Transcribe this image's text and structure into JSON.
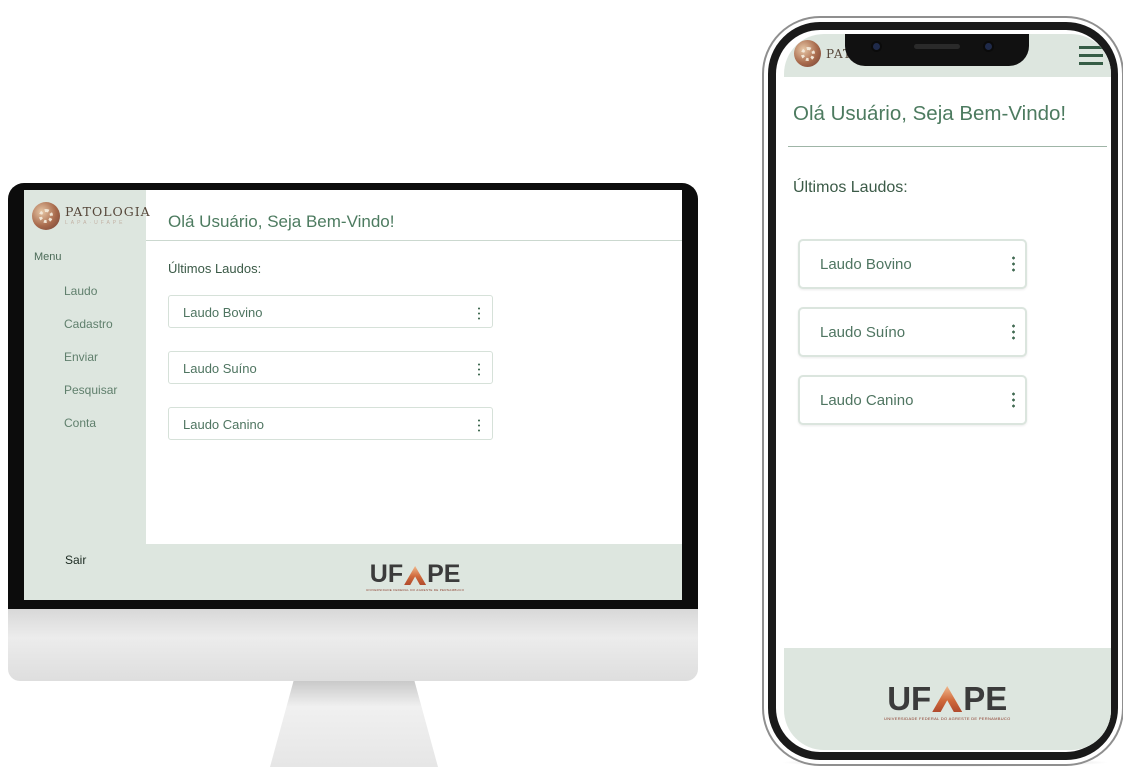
{
  "app": {
    "logo_name": "PATOLOGIA",
    "logo_sub": "LAPA·UFAPE"
  },
  "desktop": {
    "menu_label": "Menu",
    "nav": [
      "Laudo",
      "Cadastro",
      "Enviar",
      "Pesquisar",
      "Conta"
    ],
    "logout": "Sair",
    "greeting": "Olá Usuário, Seja Bem-Vindo!",
    "section": "Últimos Laudos:",
    "reports": [
      "Laudo Bovino",
      "Laudo Suíno",
      "Laudo Canino"
    ]
  },
  "mobile": {
    "logo_name": "PAT",
    "greeting": "Olá Usuário, Seja Bem-Vindo!",
    "section": "Últimos Laudos:",
    "reports": [
      "Laudo Bovino",
      "Laudo Suíno",
      "Laudo Canino"
    ]
  },
  "footer": {
    "logo_left": "UF",
    "logo_right": "PE",
    "logo_sub": "UNIVERSIDADE FEDERAL DO AGRESTE DE PERNAMBUCO"
  },
  "colors": {
    "brand_green": "#4d7b60",
    "sidebar_bg": "#dde6df",
    "logo_accent": "#d06a3c"
  },
  "icons": {
    "menu": "hamburger-menu-icon",
    "card_options": "kebab-menu-icon",
    "logo": "patologia-logo-icon"
  }
}
